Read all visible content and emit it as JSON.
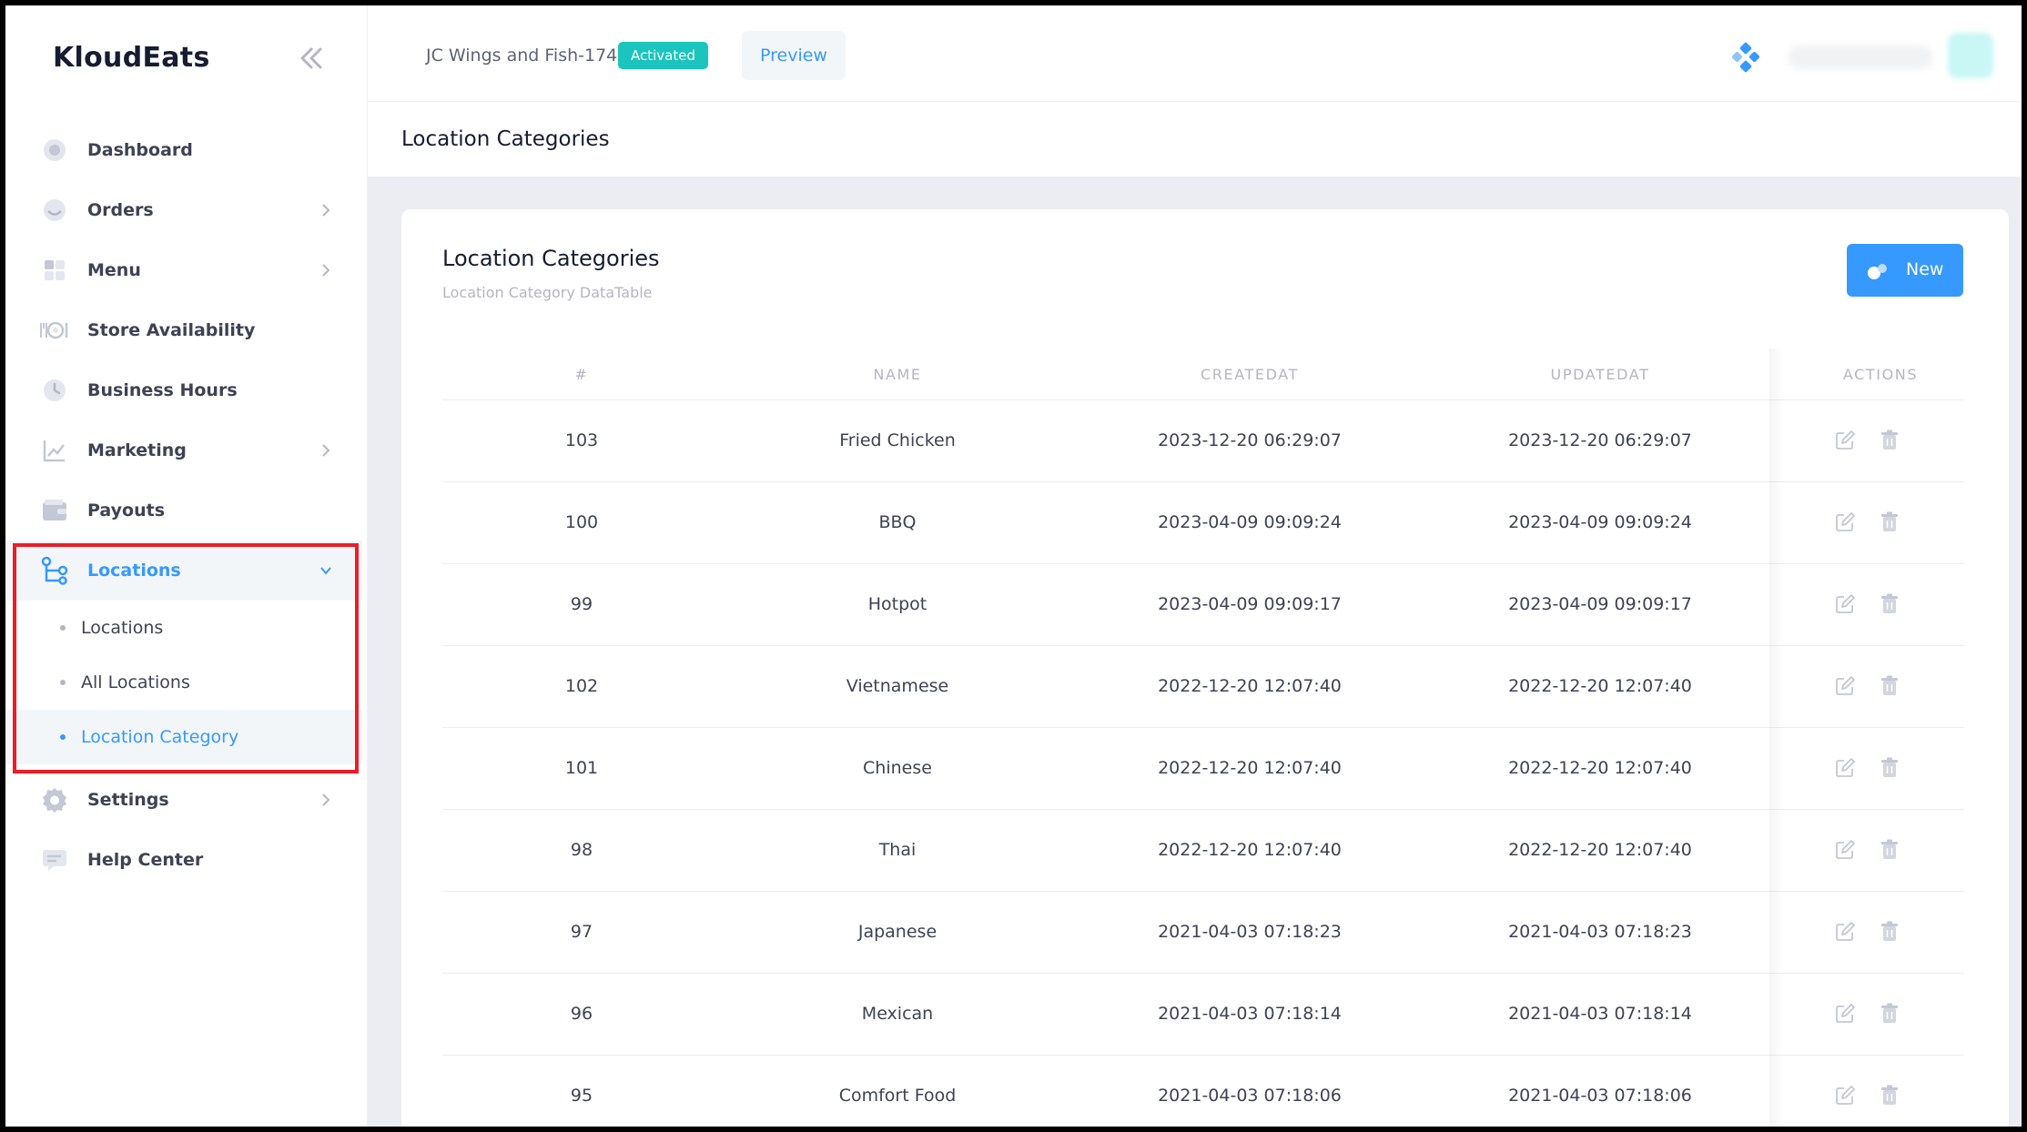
{
  "brand": {
    "name": "KloudEats"
  },
  "sidebar": {
    "items": [
      {
        "label": "Dashboard",
        "icon": "dashboard-icon"
      },
      {
        "label": "Orders",
        "icon": "orders-icon"
      },
      {
        "label": "Menu",
        "icon": "menu-icon"
      },
      {
        "label": "Store Availability",
        "icon": "store-availability-icon"
      },
      {
        "label": "Business Hours",
        "icon": "clock-icon"
      },
      {
        "label": "Marketing",
        "icon": "chart-icon"
      },
      {
        "label": "Payouts",
        "icon": "wallet-icon"
      },
      {
        "label": "Locations",
        "icon": "locations-icon"
      },
      {
        "label": "Settings",
        "icon": "gear-icon"
      },
      {
        "label": "Help Center",
        "icon": "chat-icon"
      }
    ],
    "locations_submenu": [
      {
        "label": "Locations"
      },
      {
        "label": "All Locations"
      },
      {
        "label": "Location Category"
      }
    ]
  },
  "header": {
    "store_name": "JC Wings and Fish-174",
    "status": "Activated",
    "preview_label": "Preview"
  },
  "subheader": {
    "title": "Location Categories"
  },
  "card": {
    "title": "Location Categories",
    "subtitle": "Location Category DataTable",
    "new_label": "New"
  },
  "table": {
    "columns": [
      "#",
      "NAME",
      "CREATEDAT",
      "UPDATEDAT",
      "ACTIONS"
    ],
    "rows": [
      {
        "id": "103",
        "name": "Fried Chicken",
        "created": "2023-12-20 06:29:07",
        "updated": "2023-12-20 06:29:07"
      },
      {
        "id": "100",
        "name": "BBQ",
        "created": "2023-04-09 09:09:24",
        "updated": "2023-04-09 09:09:24"
      },
      {
        "id": "99",
        "name": "Hotpot",
        "created": "2023-04-09 09:09:17",
        "updated": "2023-04-09 09:09:17"
      },
      {
        "id": "102",
        "name": "Vietnamese",
        "created": "2022-12-20 12:07:40",
        "updated": "2022-12-20 12:07:40"
      },
      {
        "id": "101",
        "name": "Chinese",
        "created": "2022-12-20 12:07:40",
        "updated": "2022-12-20 12:07:40"
      },
      {
        "id": "98",
        "name": "Thai",
        "created": "2022-12-20 12:07:40",
        "updated": "2022-12-20 12:07:40"
      },
      {
        "id": "97",
        "name": "Japanese",
        "created": "2021-04-03 07:18:23",
        "updated": "2021-04-03 07:18:23"
      },
      {
        "id": "96",
        "name": "Mexican",
        "created": "2021-04-03 07:18:14",
        "updated": "2021-04-03 07:18:14"
      },
      {
        "id": "95",
        "name": "Comfort Food",
        "created": "2021-04-03 07:18:06",
        "updated": "2021-04-03 07:18:06"
      }
    ]
  },
  "colors": {
    "primary": "#3699ff",
    "success": "#1bc5bd",
    "annotation": "#ee1c25",
    "text": "#3f4254",
    "muted": "#b5b5c3"
  }
}
